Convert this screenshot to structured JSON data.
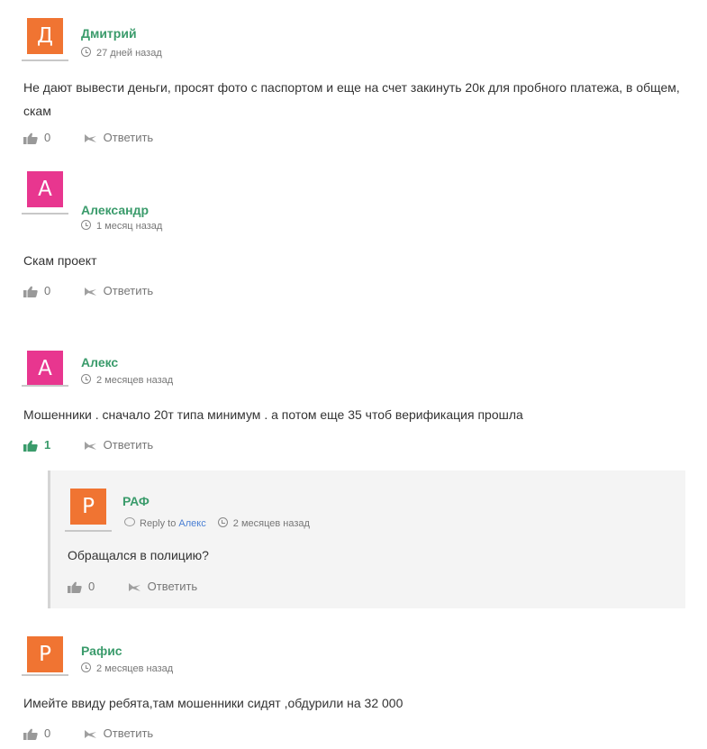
{
  "colors": {
    "orange": "#f07432",
    "pink": "#e8368f",
    "author": "#3a9b6b",
    "link": "#4a7fd4"
  },
  "comments": [
    {
      "initial": "Д",
      "avatar_color": "#f07432",
      "author": "Дмитрий",
      "time": "27 дней назад",
      "text": "Не дают вывести деньги, просят фото с паспортом и еще на счет закинуть 20к для пробного платежа, в общем, скам",
      "likes": "0",
      "reply_label": "Ответить"
    },
    {
      "initial": "А",
      "avatar_color": "#e8368f",
      "author": "Александр",
      "time": "1 месяц назад",
      "text": "Скам проект",
      "likes": "0",
      "reply_label": "Ответить"
    },
    {
      "initial": "А",
      "avatar_color": "#e8368f",
      "author": "Алекс",
      "time": "2 месяцев назад",
      "text": "Мошенники . сначало 20т типа минимум . а потом еще 35 чтоб верификация прошла",
      "likes": "1",
      "reply_label": "Ответить"
    },
    {
      "initial": "Р",
      "avatar_color": "#f07432",
      "author": "РАФ",
      "reply_to_label": "Reply to",
      "reply_to": "Алекс",
      "time": "2 месяцев назад",
      "text": "Обращался в полицию?",
      "likes": "0",
      "reply_label": "Ответить"
    },
    {
      "initial": "Р",
      "avatar_color": "#f07432",
      "author": "Рафис",
      "time": "2 месяцев назад",
      "text": "Имейте ввиду ребята,там мошенники сидят ,обдурили на 32 000",
      "likes": "0",
      "reply_label": "Ответить"
    }
  ]
}
